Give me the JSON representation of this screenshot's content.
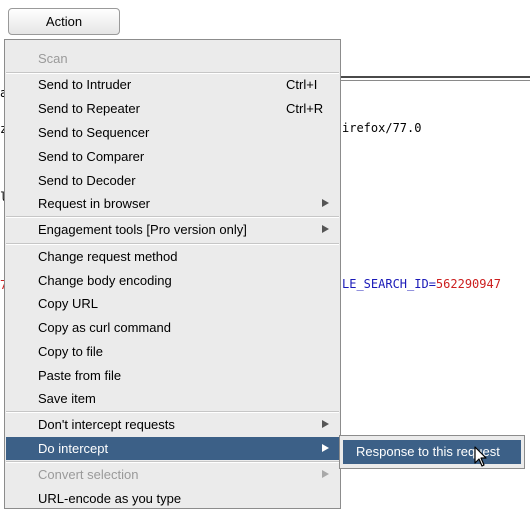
{
  "toolbar": {
    "action_label": "Action"
  },
  "editor": {
    "line_useragent": "irefox/77.0",
    "line_param_key": "LE_SEARCH_ID=",
    "line_param_val": "562290947",
    "edge_chars": [
      "a",
      "z",
      "l",
      "7"
    ]
  },
  "menu": {
    "scan": "Scan",
    "send_to_intruder": "Send to Intruder",
    "send_to_intruder_shortcut": "Ctrl+I",
    "send_to_repeater": "Send to Repeater",
    "send_to_repeater_shortcut": "Ctrl+R",
    "send_to_sequencer": "Send to Sequencer",
    "send_to_comparer": "Send to Comparer",
    "send_to_decoder": "Send to Decoder",
    "request_in_browser": "Request in browser",
    "engagement_tools": "Engagement tools [Pro version only]",
    "change_request_method": "Change request method",
    "change_body_encoding": "Change body encoding",
    "copy_url": "Copy URL",
    "copy_as_curl": "Copy as curl command",
    "copy_to_file": "Copy to file",
    "paste_from_file": "Paste from file",
    "save_item": "Save item",
    "dont_intercept": "Don't intercept requests",
    "do_intercept": "Do intercept",
    "convert_selection": "Convert selection",
    "url_encode": "URL-encode as you type"
  },
  "submenu": {
    "response_to_this_request": "Response to this request"
  },
  "colors": {
    "selection": "#3c6087",
    "menu_bg": "#ebebeb",
    "param_key": "#1a1ab8",
    "param_value": "#cc1f1f"
  }
}
